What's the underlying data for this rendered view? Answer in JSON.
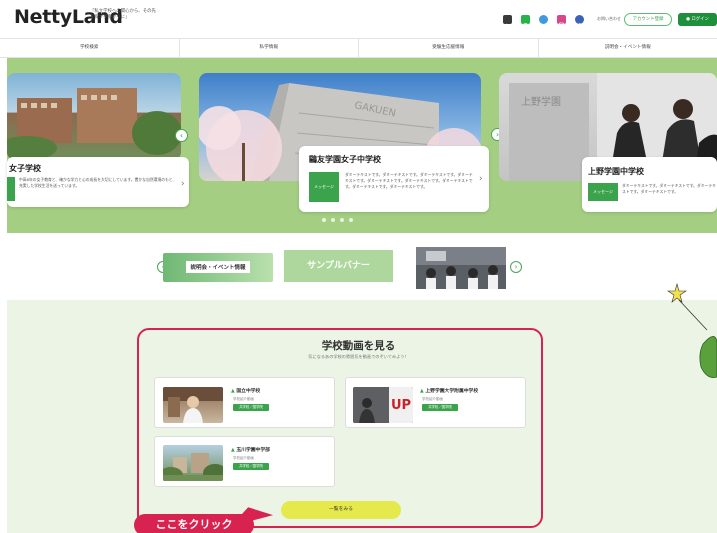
{
  "header": {
    "logo": "NettyLand",
    "tagline": "「私立学校への関心から、その先を探す手掛かりに」",
    "sns_icons": [
      "youtube-icon",
      "line-icon",
      "twitter-icon",
      "instagram-icon",
      "facebook-icon"
    ],
    "contact_link": "お問い合わせ",
    "outline_button": "アカウント登録",
    "green_button": "ログイン"
  },
  "nav": {
    "items": [
      "学校検索",
      "私学情報",
      "受験生応援情報",
      "説明会・イベント情報"
    ]
  },
  "carousel": {
    "slides": [
      {
        "title": "女子学校",
        "badge": "",
        "text": "中高6年の女子教育と、確かな学力と心の成長を大切にしています。豊かな自然環境のもと、充実した学校生活を送っています。"
      },
      {
        "title": "鷗友学園女子中学校",
        "badge": "メッセージ",
        "text": "ダミーテキストです。ダミーテキストです。ダミーテキストです。ダミーテキストです。ダミーテキストです。ダミーテキストです。ダミーテキストです。ダミーテキストです。ダミーテキストです。"
      },
      {
        "title": "上野学園中学校",
        "badge": "メッセージ",
        "text": "ダミーテキストです。ダミーテキストです。ダミーテキストです。ダミーテキストです。"
      }
    ],
    "photo_sign": "上野学園",
    "building_sign": "GAKUEN",
    "active_dot": 0,
    "dot_count": 4
  },
  "banners": {
    "banner1": "説明会・イベント情報",
    "banner2": "サンプルバナー"
  },
  "video": {
    "title": "学校動画を見る",
    "subtitle": "気になるあの学校の雰囲気を動画でのぞいてみよう！",
    "schools": [
      {
        "name": "国立中学校",
        "meta": "学校紹介動画",
        "tag": "共学校／国学院"
      },
      {
        "name": "上野学園大学附属中学校",
        "meta": "学校紹介動画",
        "tag": "共学校／国学院"
      },
      {
        "name": "玉川学園中学部",
        "meta": "学校紹介動画",
        "tag": "共学校／国学院"
      }
    ],
    "photo_sign": "UP",
    "more_button": "一覧をみる",
    "callout": "ここをクリック"
  },
  "colors": {
    "green_band": "#a4cf82",
    "accent_green": "#3aa34b",
    "callout_red": "#d8224f",
    "more_yellow": "#e6e94c"
  }
}
